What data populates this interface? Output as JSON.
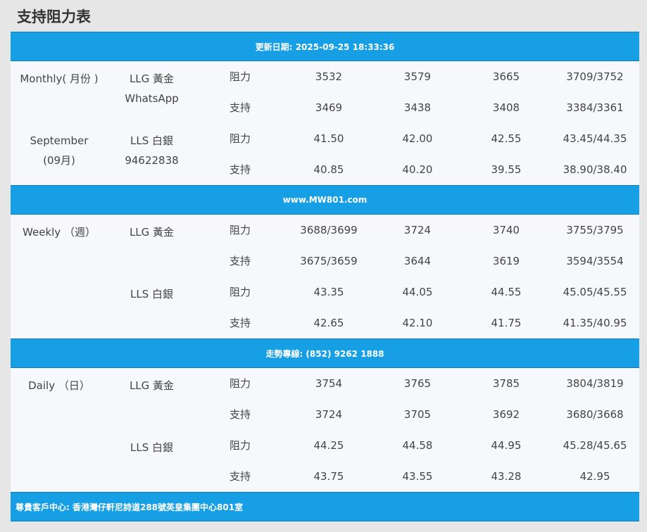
{
  "title": "支持阻力表",
  "banners": {
    "update": "更新日期: 2025-09-25 18:33:36",
    "website": "www.MW801.com",
    "hotline": "走勢專線: (852) 9262 1888",
    "address": "尊貴客戶中心: 香港灣仔軒尼詩道288號英皇集團中心801室"
  },
  "monthly": {
    "period": "Monthly( 月份 )",
    "month_en": "September",
    "month_zh": "(09月)",
    "llg_label": "LLG 黃金",
    "llg_sub": "WhatsApp",
    "lls_label": "LLS 白銀",
    "lls_sub": "94622838",
    "llg_res": [
      "3532",
      "3579",
      "3665",
      "3709/3752"
    ],
    "llg_sup": [
      "3469",
      "3438",
      "3408",
      "3384/3361"
    ],
    "lls_res": [
      "41.50",
      "42.00",
      "42.55",
      "43.45/44.35"
    ],
    "lls_sup": [
      "40.85",
      "40.20",
      "39.55",
      "38.90/38.40"
    ]
  },
  "weekly": {
    "period": "Weekly （週）",
    "llg_label": "LLG 黃金",
    "lls_label": "LLS 白銀",
    "llg_res": [
      "3688/3699",
      "3724",
      "3740",
      "3755/3795"
    ],
    "llg_sup": [
      "3675/3659",
      "3644",
      "3619",
      "3594/3554"
    ],
    "lls_res": [
      "43.35",
      "44.05",
      "44.55",
      "45.05/45.55"
    ],
    "lls_sup": [
      "42.65",
      "42.10",
      "41.75",
      "41.35/40.95"
    ]
  },
  "daily": {
    "period": "Daily （日）",
    "llg_label": "LLG 黃金",
    "lls_label": "LLS 白銀",
    "llg_res": [
      "3754",
      "3765",
      "3785",
      "3804/3819"
    ],
    "llg_sup": [
      "3724",
      "3705",
      "3692",
      "3680/3668"
    ],
    "lls_res": [
      "44.25",
      "44.58",
      "44.95",
      "45.28/45.65"
    ],
    "lls_sup": [
      "43.75",
      "43.55",
      "43.28",
      "42.95"
    ]
  },
  "labels": {
    "resistance": "阻力",
    "support": "支持"
  },
  "colors": {
    "banner": "#179fe6",
    "table_bg": "#f7f8fb",
    "page_bg": "#e6e6e6"
  }
}
